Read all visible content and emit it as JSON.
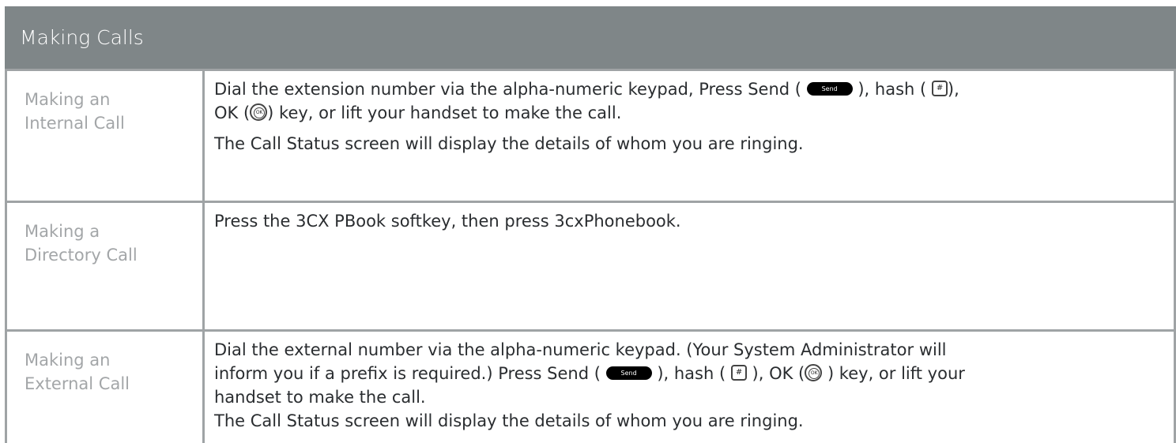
{
  "header": {
    "title": "Making Calls"
  },
  "rows": [
    {
      "label": [
        "Making an",
        "Internal Call"
      ],
      "p1": {
        "a": "Dial the extension number via the alpha-numeric keypad, Press Send (",
        "b": "), hash (",
        "c": "),",
        "d": "OK (",
        "e": ") key, or lift your handset to make the call."
      },
      "p2": "The Call Status screen will display the details of whom you are ringing."
    },
    {
      "label": [
        "Making a",
        "Directory Call"
      ],
      "p1": "Press the 3CX PBook softkey, then press 3cxPhonebook."
    },
    {
      "label": [
        "Making an",
        "External Call"
      ],
      "p1": {
        "a": "Dial the external number via the alpha-numeric keypad. (Your System Administrator will",
        "b": "inform you if a prefix is required.) Press Send (",
        "c": "), hash (",
        "d": "), OK (",
        "e": ") key, or lift your",
        "f": "handset to make the call."
      },
      "p2": "The Call Status screen will display the details of whom you are ringing."
    }
  ],
  "keys": {
    "send": "Send",
    "hash": "#",
    "ok": "OK"
  }
}
